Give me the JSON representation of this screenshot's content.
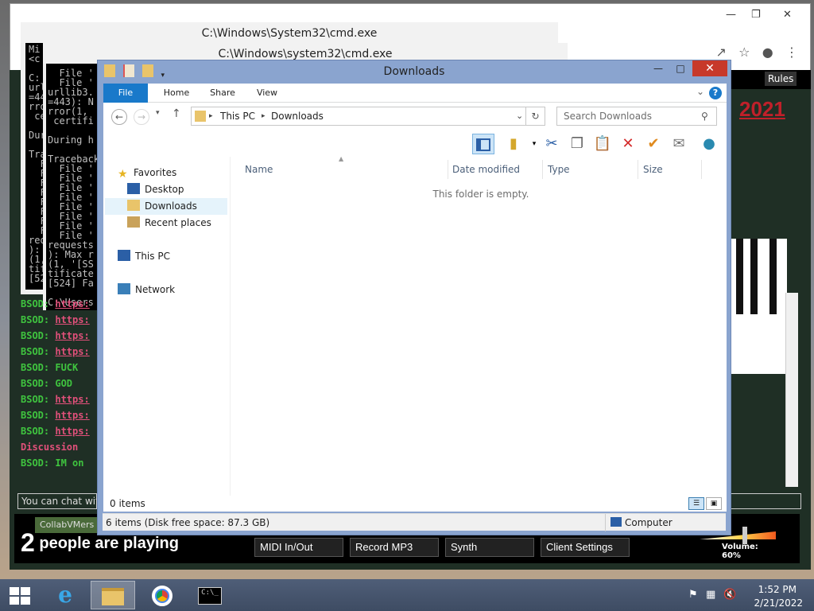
{
  "cmd_windows": [
    {
      "title": "C:\\Windows\\System32\\cmd.exe",
      "lines": [
        "Mi",
        "<c",
        "",
        "C:",
        "urllib3.",
        "=443): M",
        "rror(1,",
        " certifi",
        "",
        "During h",
        "",
        "Traceback",
        "  File",
        "  File",
        "  File",
        "  File",
        "  File",
        "  File",
        "  File",
        "  File",
        "requests",
        "): Max r",
        "(1, '[SS",
        "tificate",
        "[524] Fa",
        "",
        "C:\\Users"
      ]
    },
    {
      "title": "C:\\Windows\\system32\\cmd.exe",
      "lines": [
        "  File '",
        "  File '",
        "urllib3.",
        "=443): N",
        "rror(1,",
        " certifi",
        "",
        "During h",
        "",
        "Traceback",
        "  File '",
        "  File '",
        "  File '",
        "  File '",
        "  File '",
        "  File '",
        "  File '",
        "  File '",
        "requests",
        "): Max r",
        "(1, '[SS",
        "tificate",
        "[524] Fa",
        "",
        "C:\\Users"
      ]
    }
  ],
  "background_site": {
    "rules_label": "Rules",
    "year_text": "2021",
    "chat": [
      {
        "who": "BSOD:",
        "msg": "https:",
        "link": true
      },
      {
        "who": "BSOD:",
        "msg": "https:",
        "link": true
      },
      {
        "who": "BSOD:",
        "msg": "https:",
        "link": true
      },
      {
        "who": "BSOD:",
        "msg": "https:",
        "link": true
      },
      {
        "who": "BSOD:",
        "msg": "FUCK",
        "link": false
      },
      {
        "who": "BSOD:",
        "msg": "GOD",
        "link": false
      },
      {
        "who": "BSOD:",
        "msg": "https:",
        "link": true
      },
      {
        "who": "BSOD:",
        "msg": "https:",
        "link": true
      },
      {
        "who": "BSOD:",
        "msg": "https:",
        "link": true
      },
      {
        "who": "",
        "msg": "Discussion",
        "link": false
      },
      {
        "who": "BSOD:",
        "msg": "IM on",
        "link": false
      }
    ],
    "chat_placeholder": "You can chat wit",
    "collab_chip": "CollabVMers",
    "players_count": "2",
    "players_text": "people are playing",
    "buttons": [
      "MIDI In/Out",
      "Record MP3",
      "Synth",
      "Client Settings"
    ],
    "volume_label": "Volume: 60%",
    "volume_level": 0.6
  },
  "explorer": {
    "title": "Downloads",
    "ribbon_tabs": [
      "File",
      "Home",
      "Share",
      "View"
    ],
    "help_label": "?",
    "breadcrumb": [
      "This PC",
      "Downloads"
    ],
    "search_placeholder": "Search Downloads",
    "nav": {
      "favorites_label": "Favorites",
      "favorites": [
        "Desktop",
        "Downloads",
        "Recent places"
      ],
      "this_pc_label": "This PC",
      "network_label": "Network",
      "selected": "Downloads"
    },
    "columns": [
      "Name",
      "Date modified",
      "Type",
      "Size"
    ],
    "empty_message": "This folder is empty.",
    "status_items": "0 items",
    "details_text": "6 items (Disk free space: 87.3 GB)",
    "details_location": "Computer"
  },
  "taskbar": {
    "time": "1:52 PM",
    "date": "2/21/2022",
    "apps": [
      "internet-explorer",
      "file-explorer",
      "chrome",
      "command-prompt"
    ],
    "active_app": "file-explorer"
  },
  "colors": {
    "accent": "#1979ca",
    "close": "#c7392a",
    "chat_green": "#3fc43f",
    "chat_link": "#e0507a"
  }
}
